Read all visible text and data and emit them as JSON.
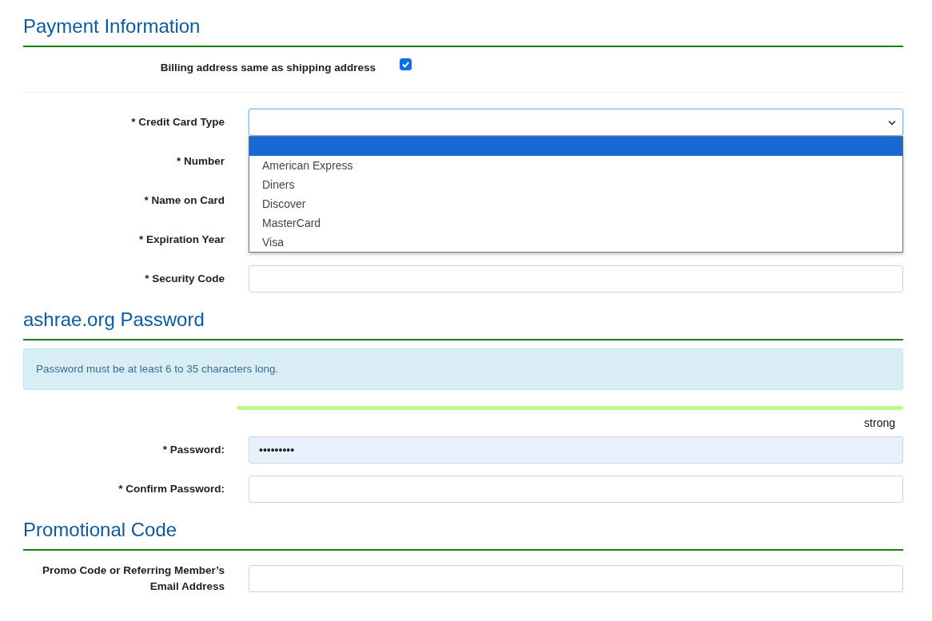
{
  "sections": [
    {
      "title": "Payment Information",
      "rows": [
        {
          "kind": "checkbox",
          "label": "Billing address same as shipping address",
          "checked": true
        },
        {
          "kind": "divider"
        },
        {
          "kind": "select",
          "label": "* Credit Card Type",
          "expanded": true,
          "options": [
            {
              "selected": true
            },
            {
              "label": "American Express",
              "selected": false
            },
            {
              "label": "Diners",
              "selected": false
            },
            {
              "label": "Discover",
              "selected": false
            },
            {
              "label": "MasterCard",
              "selected": false
            },
            {
              "label": "Visa",
              "selected": false
            }
          ]
        },
        {
          "kind": "covered",
          "label": "* Number"
        },
        {
          "kind": "covered",
          "label": "* Name on Card"
        },
        {
          "kind": "covered",
          "label": "* Expiration Year"
        },
        {
          "kind": "text",
          "label": "* Security Code",
          "value": ""
        }
      ]
    },
    {
      "title": "ashrae.org Password",
      "rows": [
        {
          "kind": "notice",
          "text": "Password must be at least 6 to 35 characters long."
        },
        {
          "kind": "strength",
          "level": 1,
          "reading": "strong"
        },
        {
          "kind": "password",
          "label": "* Password:",
          "value": "•••••••••",
          "autofilled": true
        },
        {
          "kind": "password",
          "label": "* Confirm Password:",
          "value": "",
          "autofilled": false
        }
      ]
    },
    {
      "title": "Promotional Code",
      "rows": [
        {
          "kind": "text",
          "label": "Promo Code or Referring Member’s Email Address",
          "value": ""
        }
      ]
    }
  ]
}
